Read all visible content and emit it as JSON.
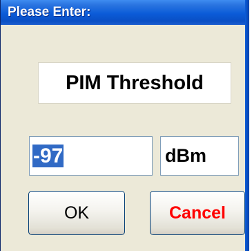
{
  "dialog": {
    "title": "Please Enter:",
    "field_label": "PIM Threshold",
    "value": "-97",
    "unit": "dBm",
    "ok_label": "OK",
    "cancel_label": "Cancel"
  },
  "colors": {
    "titlebar": "#0b5bd8",
    "dialog_bg": "#ece9d8",
    "selection": "#316ac5",
    "cancel_text": "#ff0000"
  }
}
